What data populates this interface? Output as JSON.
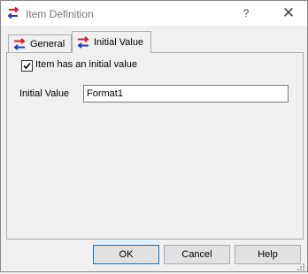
{
  "window": {
    "title": "Item Definition",
    "help_glyph": "?",
    "close_glyph": "✕",
    "icon": "item-definition-icon"
  },
  "tabs": [
    {
      "label": "General",
      "active": false,
      "icon": "swap-arrows-icon"
    },
    {
      "label": "Initial Value",
      "active": true,
      "icon": "swap-arrows-icon"
    }
  ],
  "panel": {
    "checkbox_label": "Item has an initial value",
    "checkbox_checked": true,
    "initial_value_label": "Initial Value",
    "initial_value": "Format1"
  },
  "buttons": {
    "ok": "OK",
    "cancel": "Cancel",
    "help": "Help"
  },
  "colors": {
    "icon_red": "#d42020",
    "icon_blue": "#1f3fbf",
    "default_button_border": "#0078d7"
  }
}
